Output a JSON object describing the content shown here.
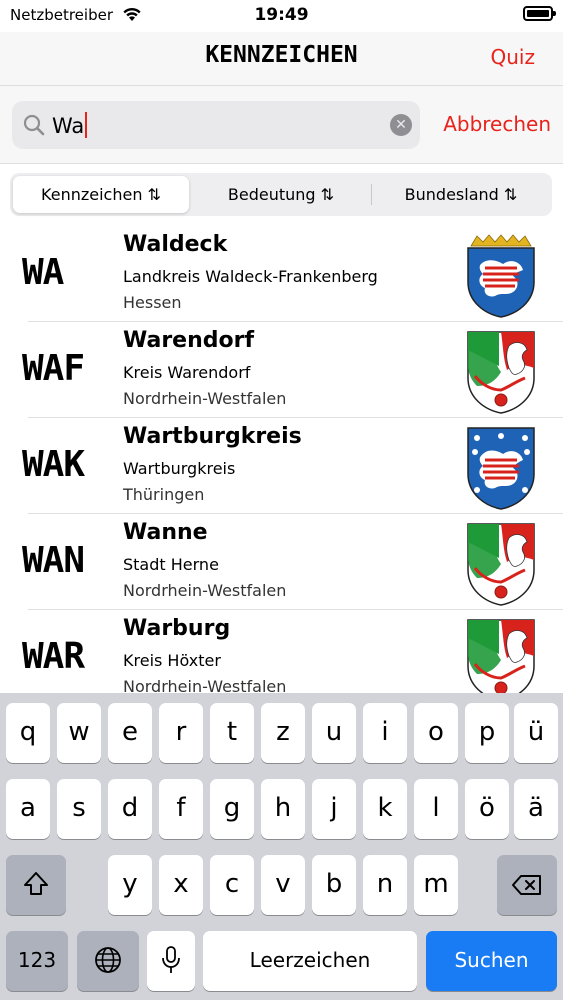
{
  "status": {
    "carrier": "Netzbetreiber",
    "time": "19:49"
  },
  "nav": {
    "title": "KENNZEICHEN",
    "quiz": "Quiz"
  },
  "search": {
    "value": "Wa",
    "cancel": "Abbrechen"
  },
  "segments": [
    "Kennzeichen ⇅",
    "Bedeutung ⇅",
    "Bundesland ⇅"
  ],
  "results": [
    {
      "plate": "WA",
      "title": "Waldeck",
      "sub": "Landkreis Waldeck-Frankenberg",
      "state": "Hessen",
      "crest": "hessen-crest-icon"
    },
    {
      "plate": "WAF",
      "title": "Warendorf",
      "sub": "Kreis Warendorf",
      "state": "Nordrhein-Westfalen",
      "crest": "nrw-crest-icon"
    },
    {
      "plate": "WAK",
      "title": "Wartburgkreis",
      "sub": "Wartburgkreis",
      "state": "Thüringen",
      "crest": "thueringen-crest-icon"
    },
    {
      "plate": "WAN",
      "title": "Wanne",
      "sub": "Stadt Herne",
      "state": "Nordrhein-Westfalen",
      "crest": "nrw-crest-icon"
    },
    {
      "plate": "WAR",
      "title": "Warburg",
      "sub": "Kreis Höxter",
      "state": "Nordrhein-Westfalen",
      "crest": "nrw-crest-icon"
    }
  ],
  "keyboard": {
    "row1": [
      "q",
      "w",
      "e",
      "r",
      "t",
      "z",
      "u",
      "i",
      "o",
      "p",
      "ü"
    ],
    "row2": [
      "a",
      "s",
      "d",
      "f",
      "g",
      "h",
      "j",
      "k",
      "l",
      "ö",
      "ä"
    ],
    "row3": [
      "y",
      "x",
      "c",
      "v",
      "b",
      "n",
      "m"
    ],
    "num": "123",
    "space": "Leerzeichen",
    "submit": "Suchen"
  },
  "colors": {
    "accent": "#e8231c",
    "submit": "#1a7cf5"
  }
}
